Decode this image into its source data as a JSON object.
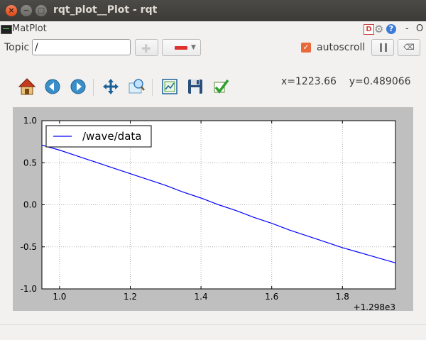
{
  "window": {
    "title": "rqt_plot__Plot - rqt",
    "close_glyph": "×",
    "minimize_glyph": "−",
    "maximize_glyph": "□"
  },
  "plugin": {
    "label": "MatPlot",
    "d_glyph": "D",
    "help_glyph": "?",
    "dash_label": "-",
    "o_label": "O"
  },
  "controls": {
    "topic_label": "Topic",
    "topic_value": "/",
    "autoscroll_label": "autoscroll",
    "autoscroll_checked": true,
    "clear_glyph": "⌫"
  },
  "toolbar": {
    "icons": [
      "home-icon",
      "back-icon",
      "forward-icon",
      "pan-icon",
      "zoom-icon",
      "subplots-icon",
      "save-icon",
      "apply-icon"
    ],
    "x_readout": "x=1223.66",
    "y_readout": "y=0.489066"
  },
  "chart_data": {
    "type": "line",
    "x_offset_label": "+1.298e3",
    "xlim": [
      0.95,
      1.95
    ],
    "ylim": [
      -1.0,
      1.0
    ],
    "xticks": [
      "1.0",
      "1.2",
      "1.4",
      "1.6",
      "1.8"
    ],
    "yticks": [
      "1.0",
      "0.5",
      "0.0",
      "-0.5",
      "-1.0"
    ],
    "grid": true,
    "legend_position": "top-left",
    "line_color": "#0000ff",
    "series": [
      {
        "name": "/wave/data",
        "x": [
          0.95,
          1.0,
          1.05,
          1.1,
          1.15,
          1.2,
          1.25,
          1.3,
          1.35,
          1.4,
          1.45,
          1.5,
          1.55,
          1.6,
          1.65,
          1.7,
          1.75,
          1.8,
          1.85,
          1.9,
          1.95
        ],
        "y": [
          0.71,
          0.65,
          0.58,
          0.51,
          0.44,
          0.37,
          0.3,
          0.23,
          0.15,
          0.08,
          0.0,
          -0.07,
          -0.15,
          -0.22,
          -0.3,
          -0.37,
          -0.44,
          -0.51,
          -0.57,
          -0.63,
          -0.69
        ]
      }
    ]
  }
}
